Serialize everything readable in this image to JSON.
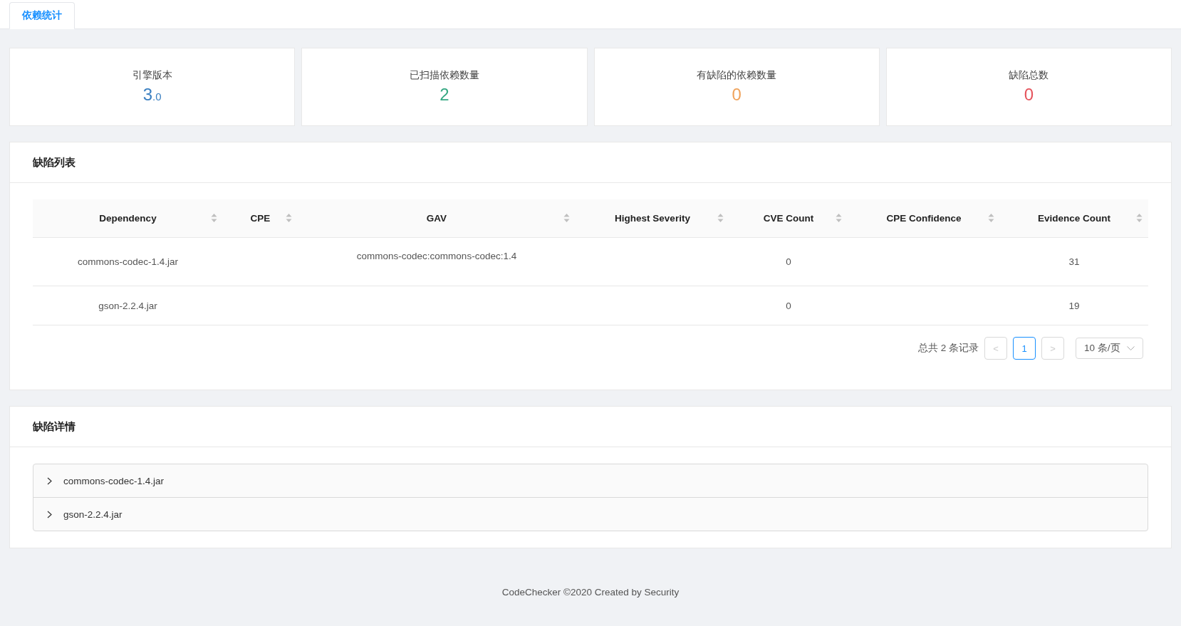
{
  "tabs": [
    {
      "label": "依赖统计",
      "selected": true
    }
  ],
  "stats": [
    {
      "label": "引擎版本",
      "value": "3$_{.0}$",
      "color": "#3a7fc1"
    },
    {
      "label": "已扫描依赖数量",
      "value": "2",
      "color": "#36a883"
    },
    {
      "label": "有缺陷的依赖数量",
      "value": "0",
      "color": "#f0a35c"
    },
    {
      "label": "缺陷总数",
      "value": "0",
      "color": "#e5545d"
    }
  ],
  "defect_list": {
    "title": "缺陷列表",
    "columns": [
      "Dependency",
      "CPE",
      "GAV",
      "Highest Severity",
      "CVE Count",
      "CPE Confidence",
      "Evidence Count"
    ],
    "rows": [
      {
        "cells": [
          "commons-codec-1.4.jar",
          null,
          "commons-codec:commons-codec:1.4",
          null,
          "0",
          null,
          "31"
        ]
      },
      {
        "cells": [
          "gson-2.2.4.jar",
          null,
          null,
          null,
          "0",
          null,
          "19"
        ]
      }
    ],
    "pagination": {
      "total": "总共 2 条记录",
      "prev": "<",
      "pages": [
        {
          "label": "1",
          "selected": true
        }
      ],
      "next": ">",
      "page_size": "10 条/页"
    }
  },
  "defect_details": {
    "title": "缺陷详情",
    "items": [
      {
        "label": "commons-codec-1.4.jar",
        "expanded": false
      },
      {
        "label": "gson-2.2.4.jar",
        "expanded": false
      }
    ]
  },
  "footer": "CodeChecker ©2020 Created by Security"
}
